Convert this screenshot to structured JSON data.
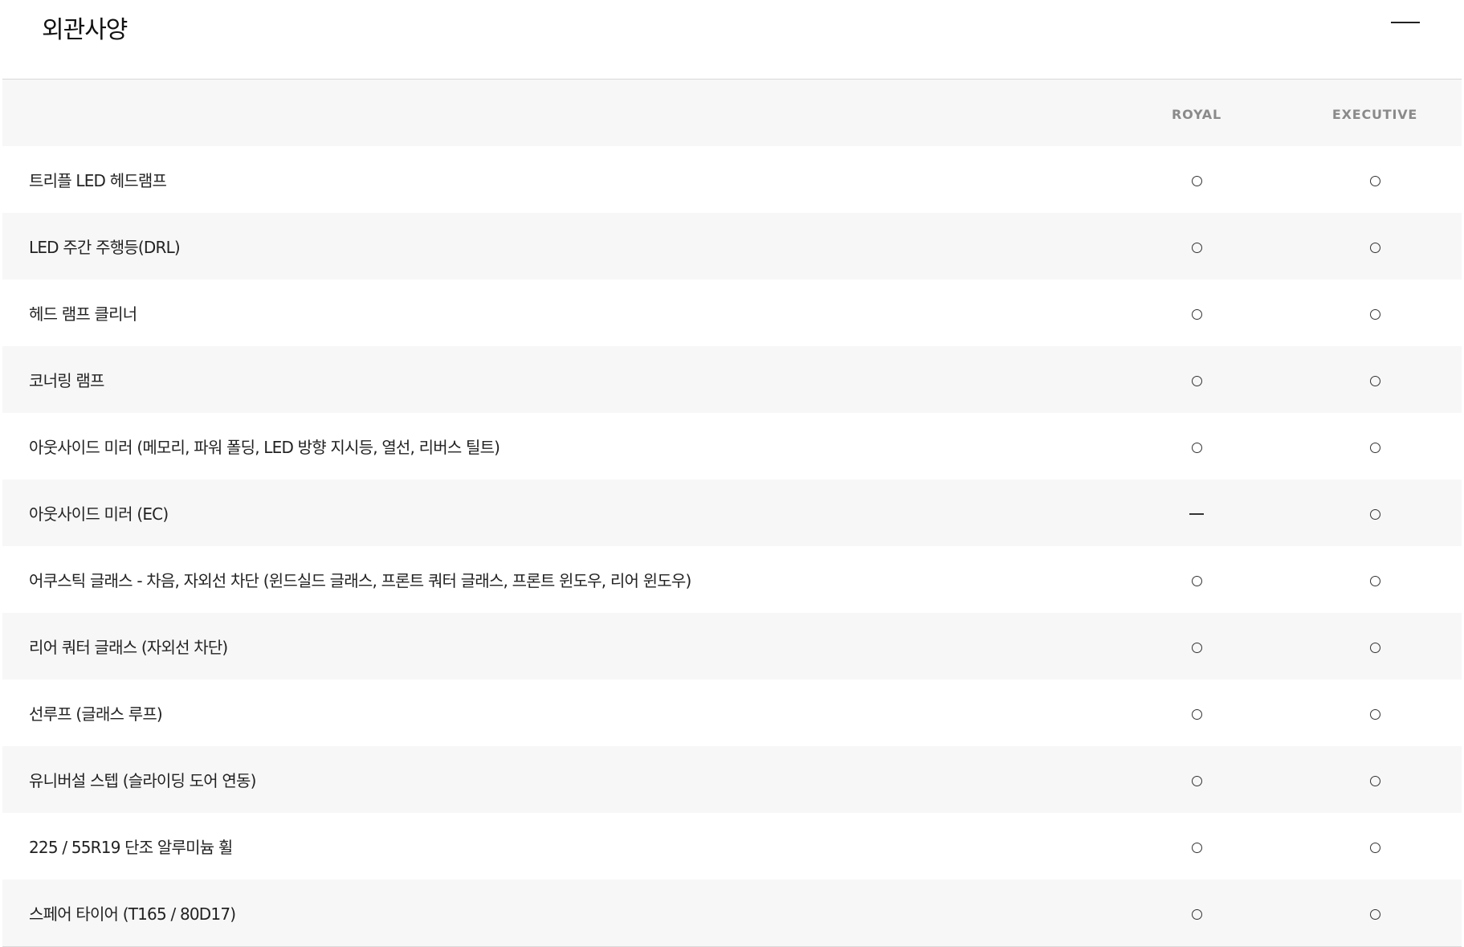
{
  "section": {
    "title": "외관사양"
  },
  "table": {
    "columns": [
      "ROYAL",
      "EXECUTIVE"
    ],
    "rows": [
      {
        "feature": "트리플 LED 헤드램프",
        "royal": "○",
        "executive": "○"
      },
      {
        "feature": "LED 주간 주행등(DRL)",
        "royal": "○",
        "executive": "○"
      },
      {
        "feature": "헤드 램프 클리너",
        "royal": "○",
        "executive": "○"
      },
      {
        "feature": "코너링 램프",
        "royal": "○",
        "executive": "○"
      },
      {
        "feature": "아웃사이드 미러 (메모리, 파워 폴딩, LED 방향 지시등, 열선, 리버스 틸트)",
        "royal": "○",
        "executive": "○"
      },
      {
        "feature": "아웃사이드 미러 (EC)",
        "royal": "—",
        "executive": "○"
      },
      {
        "feature": "어쿠스틱 글래스 - 차음, 자외선 차단 (윈드실드 글래스, 프론트 쿼터 글래스, 프론트 윈도우, 리어 윈도우)",
        "royal": "○",
        "executive": "○"
      },
      {
        "feature": "리어 쿼터 글래스 (자외선 차단)",
        "royal": "○",
        "executive": "○"
      },
      {
        "feature": "선루프 (글래스 루프)",
        "royal": "○",
        "executive": "○"
      },
      {
        "feature": "유니버설 스텝 (슬라이딩 도어 연동)",
        "royal": "○",
        "executive": "○"
      },
      {
        "feature": "225 / 55R19 단조 알루미늄 휠",
        "royal": "○",
        "executive": "○"
      },
      {
        "feature": "스페어 타이어 (T165 / 80D17)",
        "royal": "○",
        "executive": "○"
      }
    ]
  }
}
